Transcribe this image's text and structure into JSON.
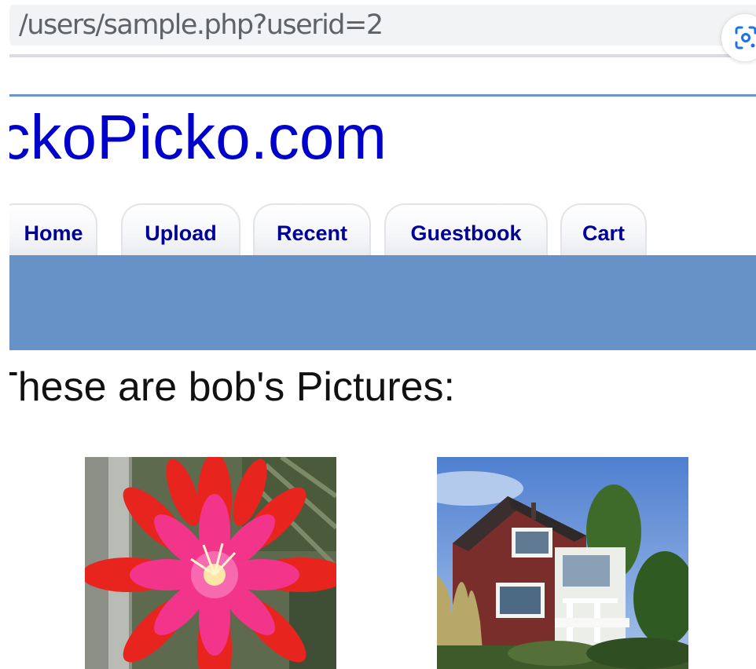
{
  "browser": {
    "address": "/users/sample.php?userid=2",
    "lens_icon": "google-lens-icon"
  },
  "site": {
    "title": "PickoPicko.com"
  },
  "nav": {
    "tabs": [
      {
        "label": "Home"
      },
      {
        "label": "Upload"
      },
      {
        "label": "Recent"
      },
      {
        "label": "Guestbook"
      },
      {
        "label": "Cart"
      }
    ]
  },
  "main": {
    "heading": "These are bob's Pictures:",
    "pictures": [
      {
        "subject": "red-pink cactus flower"
      },
      {
        "subject": "red brick house with white porch"
      }
    ]
  },
  "colors": {
    "title": "#0000cc",
    "tab_text": "#000099",
    "nav_band": "#6792c8",
    "rule": "#6a95c9"
  }
}
